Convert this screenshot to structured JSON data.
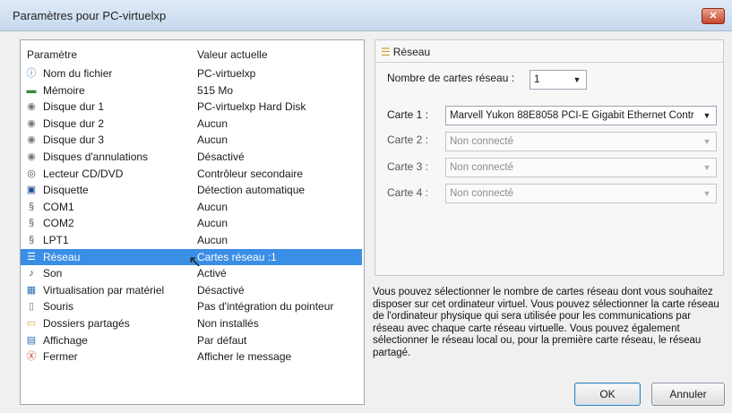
{
  "window": {
    "title": "Paramètres pour PC-virtuelxp",
    "close_label": "✕"
  },
  "settings_list": {
    "header_param": "Paramètre",
    "header_value": "Valeur actuelle",
    "items": [
      {
        "name": "Nom du fichier",
        "value": "PC-virtuelxp",
        "icon": "file-icon"
      },
      {
        "name": "Mémoire",
        "value": "515 Mo",
        "icon": "memory-icon"
      },
      {
        "name": "Disque dur 1",
        "value": "PC-virtuelxp Hard Disk",
        "icon": "hard-disk-icon"
      },
      {
        "name": "Disque dur 2",
        "value": "Aucun",
        "icon": "hard-disk-icon"
      },
      {
        "name": "Disque dur 3",
        "value": "Aucun",
        "icon": "hard-disk-icon"
      },
      {
        "name": "Disques d'annulations",
        "value": "Désactivé",
        "icon": "hard-disk-icon"
      },
      {
        "name": "Lecteur CD/DVD",
        "value": "Contrôleur secondaire",
        "icon": "cd-icon"
      },
      {
        "name": "Disquette",
        "value": "Détection automatique",
        "icon": "floppy-icon"
      },
      {
        "name": "COM1",
        "value": "Aucun",
        "icon": "serial-port-icon"
      },
      {
        "name": "COM2",
        "value": "Aucun",
        "icon": "serial-port-icon"
      },
      {
        "name": "LPT1",
        "value": "Aucun",
        "icon": "parallel-port-icon"
      },
      {
        "name": "Réseau",
        "value": "Cartes réseau :1",
        "icon": "network-icon",
        "selected": true
      },
      {
        "name": "Son",
        "value": "Activé",
        "icon": "sound-icon"
      },
      {
        "name": "Virtualisation par matériel",
        "value": "Désactivé",
        "icon": "chip-icon"
      },
      {
        "name": "Souris",
        "value": "Pas d'intégration du pointeur",
        "icon": "mouse-icon"
      },
      {
        "name": "Dossiers partagés",
        "value": "Non installés",
        "icon": "folder-icon"
      },
      {
        "name": "Affichage",
        "value": "Par défaut",
        "icon": "display-icon"
      },
      {
        "name": "Fermer",
        "value": "Afficher le message",
        "icon": "close-app-icon"
      }
    ]
  },
  "network_panel": {
    "heading": "Réseau",
    "count_label": "Nombre de cartes réseau :",
    "count_value": "1",
    "cards": [
      {
        "label": "Carte 1 :",
        "value": "Marvell Yukon 88E8058 PCI-E Gigabit Ethernet Contr",
        "enabled": true
      },
      {
        "label": "Carte 2 :",
        "value": "Non connecté",
        "enabled": false
      },
      {
        "label": "Carte 3 :",
        "value": "Non connecté",
        "enabled": false
      },
      {
        "label": "Carte 4 :",
        "value": "Non connecté",
        "enabled": false
      }
    ]
  },
  "description": "Vous pouvez sélectionner le nombre de cartes réseau dont vous souhaitez disposer sur cet ordinateur virtuel. Vous pouvez sélectionner la carte réseau de l'ordinateur physique qui sera utilisée pour les communications par réseau avec chaque carte réseau virtuelle. Vous pouvez également sélectionner le réseau local ou, pour la première carte réseau, le réseau partagé.",
  "buttons": {
    "ok": "OK",
    "cancel": "Annuler"
  },
  "colors": {
    "selection": "#3b8ee6",
    "title_bar": "#c7d9ee",
    "close_button": "#c7452d"
  }
}
